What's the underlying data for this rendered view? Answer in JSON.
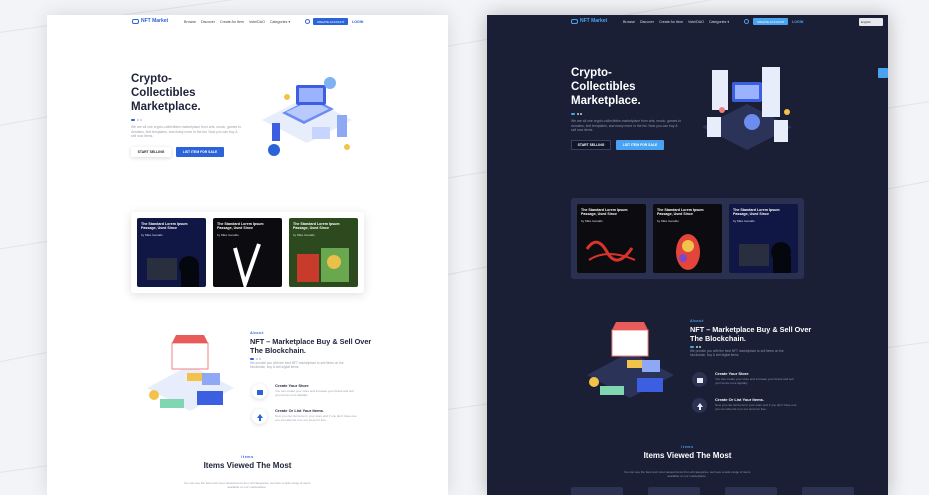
{
  "logo": "NFT Market",
  "nav": [
    "Browse",
    "Discover",
    "Create An Item",
    "Vote/DAO",
    "Categories ▾"
  ],
  "create_account": "CREATE ACCOUNT",
  "login": "LOGIN",
  "language": "English",
  "hero": {
    "title_l1": "Crypto-",
    "title_l2": "Collectibles",
    "title_l3": "Marketplace.",
    "desc": "We are all one crypto-collectibles marketplace from arts, music, games to domains, text templates, and many more in the list. Now you can buy & sell now items.",
    "btn_sell": "START SELLING",
    "btn_list": "LIST ITEM FOR SALE"
  },
  "cards": [
    {
      "title": "The Standard Lorem Ipsum Passage, Used Since",
      "by": "by Mike Geraldo"
    },
    {
      "title": "The Standard Lorem Ipsum Passage, Used Since",
      "by": "by Mike Geraldo"
    },
    {
      "title": "The Standard Lorem Ipsum Passage, Used Since",
      "by": "by Mike Geraldo"
    }
  ],
  "about": {
    "label": "About",
    "title": "NFT – Marketplace Buy & Sell Over The Blockchain.",
    "desc": "We provide you with the best NFT marketplace to sell items on the blockchain, buy & sell digital items.",
    "f1_title": "Create Your Store",
    "f1_desc": "You can create your store and increase your brand and sell your items more digitally.",
    "f2_title": "Create Or List Your Items.",
    "f2_desc": "Now you can list items in your store and if you don't have one you can also list it on our store for free."
  },
  "items": {
    "label": "Items",
    "title": "Items Viewed The Most",
    "desc": "You can see the best and most viewed items from all categories, we have a wide range of items available on our marketplace."
  },
  "colors": {
    "accent": "#2b63d9",
    "accent_dark": "#4aa3f0",
    "dark_bg": "#1a1f35"
  }
}
